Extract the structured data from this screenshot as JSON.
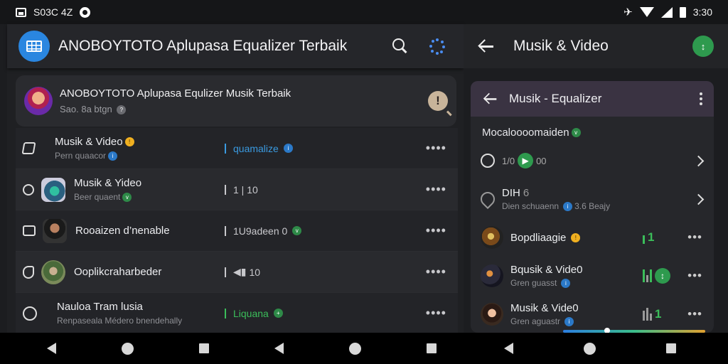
{
  "status_bar": {
    "left_text": "S03C 4Z",
    "time": "3:30"
  },
  "left": {
    "app_title": "ANOBOYTOTO  Aplupasa Equalizer Terbaik",
    "profile": {
      "name": "ANOBOYTOTO Aplupasa Equlizer Musik Terbaik",
      "sub": "Sao. 8a btgn"
    },
    "rows": [
      {
        "title": "Musik & Video",
        "sub": "Pern quaacor",
        "tag": "quamalize",
        "tag_color": "#3a9ae0"
      },
      {
        "title": "Musik & Yideo",
        "sub": "Beer quaent",
        "tag": "1 | 10",
        "tag_color": "#c8c8cc"
      },
      {
        "title": "Rooaizen d’nenable",
        "sub": "",
        "tag": "1U9adeen 0",
        "tag_color": "#c8c8cc"
      },
      {
        "title": "Ooplikcraharbeder",
        "sub": "",
        "tag": "10",
        "tag_color": "#c8c8cc"
      },
      {
        "title": "Nauloa Tram lusia",
        "sub": "Renpaseala Médero bnendehally",
        "tag": "Liquana",
        "tag_color": "#3bbd5a"
      }
    ],
    "more": "••••"
  },
  "right": {
    "app_title": "Musik & Video",
    "card_title": "Musik - Equalizer",
    "section": "Mocaloooomaiden",
    "rows": [
      {
        "title": "1/0",
        "value": "00",
        "sub": ""
      },
      {
        "title": "DIH",
        "value": "6",
        "sub": "Dien schuaenn",
        "sub2": "3.6 Beajy"
      },
      {
        "title": "Bopdliaagie",
        "sub": "",
        "meter": "1"
      },
      {
        "title": "Bqusik & Vide0",
        "sub": "Gren guasst",
        "meter": ""
      },
      {
        "title": "Musik & Vide0",
        "sub": "Gren aguastr",
        "meter": "1"
      }
    ],
    "more": "•••"
  },
  "colors": {
    "accent_blue": "#2a86e0",
    "accent_green": "#2e9a4e",
    "card_header": "#3a3342"
  }
}
